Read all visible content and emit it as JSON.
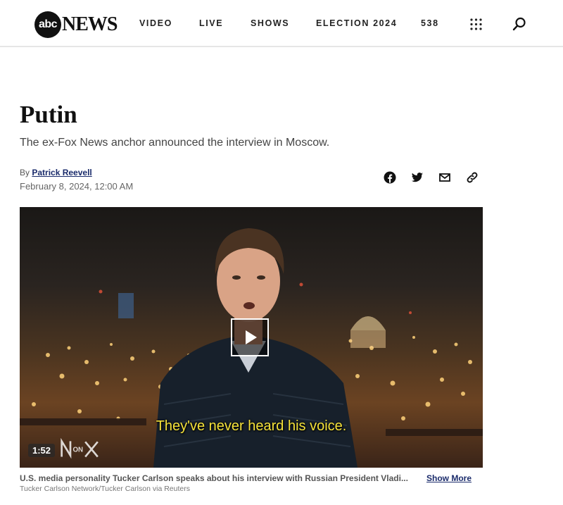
{
  "header": {
    "logo_mark": "abc",
    "logo_word": "NEWS",
    "nav": [
      "VIDEO",
      "LIVE",
      "SHOWS",
      "ELECTION 2024",
      "538"
    ],
    "grid_icon": "grid-icon",
    "search_icon": "search-icon"
  },
  "article": {
    "headline": "Putin",
    "subhead": "The ex-Fox News anchor announced the interview in Moscow.",
    "by_prefix": "By",
    "author": "Patrick Reevell",
    "date": "February 8, 2024, 12:00 AM"
  },
  "share_icons": [
    "facebook-icon",
    "twitter-icon",
    "email-icon",
    "link-icon"
  ],
  "video": {
    "subtitle": "They've never heard his voice.",
    "duration": "1:52",
    "play_icon": "play-icon"
  },
  "caption": {
    "text": "U.S. media personality Tucker Carlson speaks about his interview with Russian President Vladi...",
    "show_more": "Show More",
    "credit": "Tucker Carlson Network/Tucker Carlson via Reuters"
  }
}
